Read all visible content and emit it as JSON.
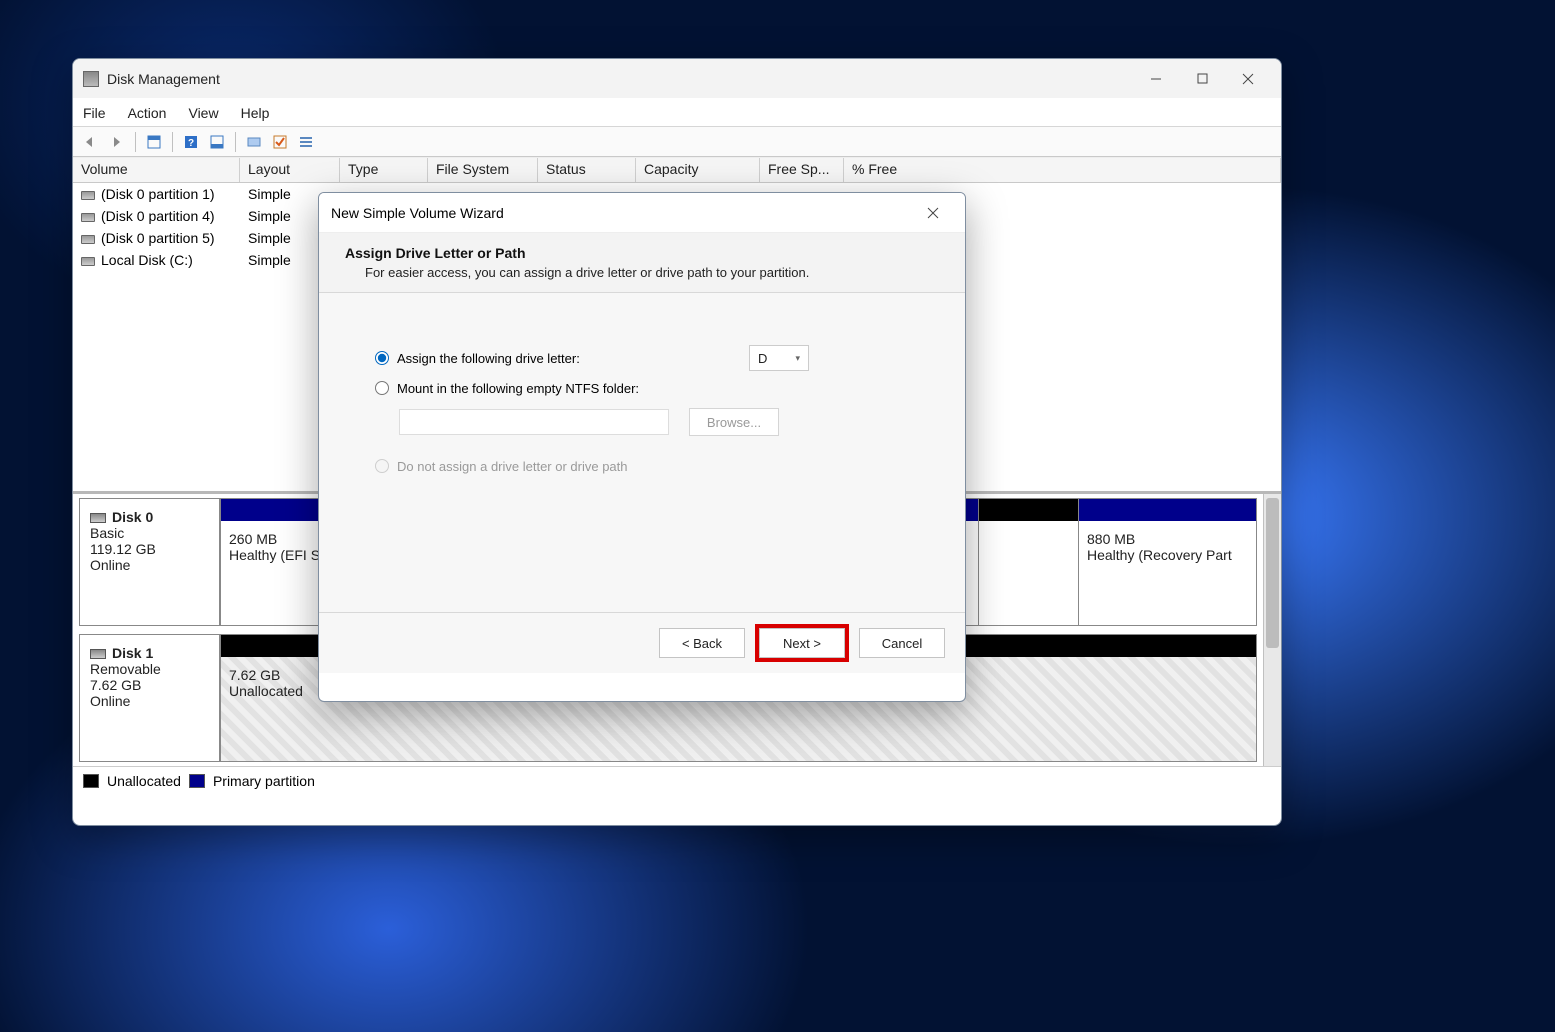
{
  "mainWindow": {
    "title": "Disk Management",
    "menu": {
      "file": "File",
      "action": "Action",
      "view": "View",
      "help": "Help"
    },
    "columns": {
      "volume": "Volume",
      "layout": "Layout",
      "type": "Type",
      "fs": "File System",
      "status": "Status",
      "capacity": "Capacity",
      "free": "Free Sp...",
      "pfree": "% Free"
    },
    "rows": [
      {
        "volume": "(Disk 0 partition 1)",
        "layout": "Simple"
      },
      {
        "volume": "(Disk 0 partition 4)",
        "layout": "Simple"
      },
      {
        "volume": "(Disk 0 partition 5)",
        "layout": "Simple"
      },
      {
        "volume": "Local Disk (C:)",
        "layout": "Simple"
      }
    ],
    "disk0": {
      "name": "Disk 0",
      "kind": "Basic",
      "size": "119.12 GB",
      "state": "Online",
      "p1_size": "260 MB",
      "p1_status": "Healthy (EFI S",
      "p2_size": "880 MB",
      "p2_status": "Healthy (Recovery Part"
    },
    "disk1": {
      "name": "Disk 1",
      "kind": "Removable",
      "size": "7.62 GB",
      "state": "Online",
      "p_size": "7.62 GB",
      "p_status": "Unallocated"
    },
    "legend": {
      "unalloc": "Unallocated",
      "primary": "Primary partition"
    }
  },
  "wizard": {
    "title": "New Simple Volume Wizard",
    "heading": "Assign Drive Letter or Path",
    "sub": "For easier access, you can assign a drive letter or drive path to your partition.",
    "opt1": "Assign the following drive letter:",
    "driveLetter": "D",
    "opt2": "Mount in the following empty NTFS folder:",
    "browse": "Browse...",
    "opt3": "Do not assign a drive letter or drive path",
    "back": "< Back",
    "next": "Next >",
    "cancel": "Cancel"
  }
}
